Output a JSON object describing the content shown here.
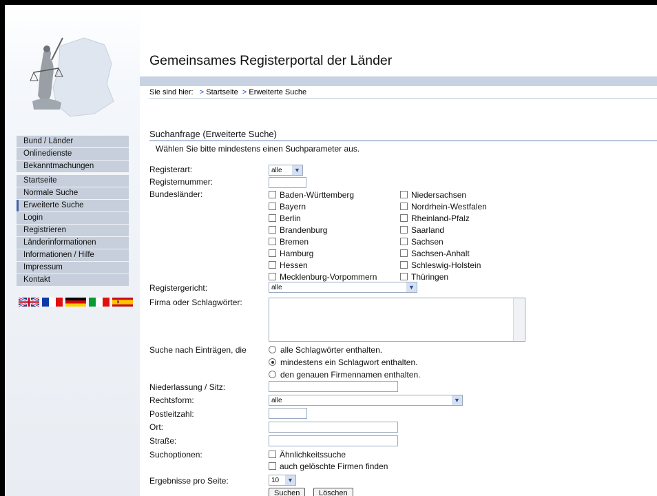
{
  "header": {
    "title": "Gemeinsames Registerportal der Länder",
    "breadcrumb_prefix": "Sie sind hier:",
    "breadcrumb": [
      "Startseite",
      "Erweiterte Suche"
    ]
  },
  "nav": {
    "group1": [
      "Bund / Länder",
      "Onlinedienste",
      "Bekanntmachungen"
    ],
    "group2": [
      "Startseite",
      "Normale Suche",
      "Erweiterte Suche",
      "Login",
      "Registrieren",
      "Länderinformationen",
      "Informationen / Hilfe",
      "Impressum",
      "Kontakt"
    ],
    "active": "Erweiterte Suche"
  },
  "flags": [
    "uk-flag",
    "france-flag",
    "germany-flag",
    "italy-flag",
    "spain-flag"
  ],
  "form": {
    "heading": "Suchanfrage (Erweiterte Suche)",
    "hint": "Wählen Sie bitte mindestens einen Suchparameter aus.",
    "registerart_label": "Registerart:",
    "registerart_value": "alle",
    "registernummer_label": "Registernummer:",
    "bundeslaender_label": "Bundesländer:",
    "laender_col1": [
      "Baden-Württemberg",
      "Bayern",
      "Berlin",
      "Brandenburg",
      "Bremen",
      "Hamburg",
      "Hessen",
      "Mecklenburg-Vorpommern"
    ],
    "laender_col2": [
      "Niedersachsen",
      "Nordrhein-Westfalen",
      "Rheinland-Pfalz",
      "Saarland",
      "Sachsen",
      "Sachsen-Anhalt",
      "Schleswig-Holstein",
      "Thüringen"
    ],
    "registergericht_label": "Registergericht:",
    "registergericht_value": "alle",
    "firma_label": "Firma oder Schlagwörter:",
    "suche_label": "Suche nach Einträgen, die",
    "radio_options": [
      "alle Schlagwörter enthalten.",
      "mindestens ein Schlagwort enthalten.",
      "den genauen Firmennamen enthalten."
    ],
    "radio_selected": 1,
    "niederlassung_label": "Niederlassung / Sitz:",
    "rechtsform_label": "Rechtsform:",
    "rechtsform_value": "alle",
    "plz_label": "Postleitzahl:",
    "ort_label": "Ort:",
    "strasse_label": "Straße:",
    "suchoptionen_label": "Suchoptionen:",
    "suchoptionen": [
      "Ähnlichkeitssuche",
      "auch gelöschte Firmen finden"
    ],
    "ergebnisse_label": "Ergebnisse pro Seite:",
    "ergebnisse_value": "10",
    "search_button": "Suchen",
    "clear_button": "Löschen"
  },
  "colors": {
    "nav_bg": "#c6cfdb",
    "accent": "#3e5fa8",
    "header_bar": "#c7d3e2"
  }
}
